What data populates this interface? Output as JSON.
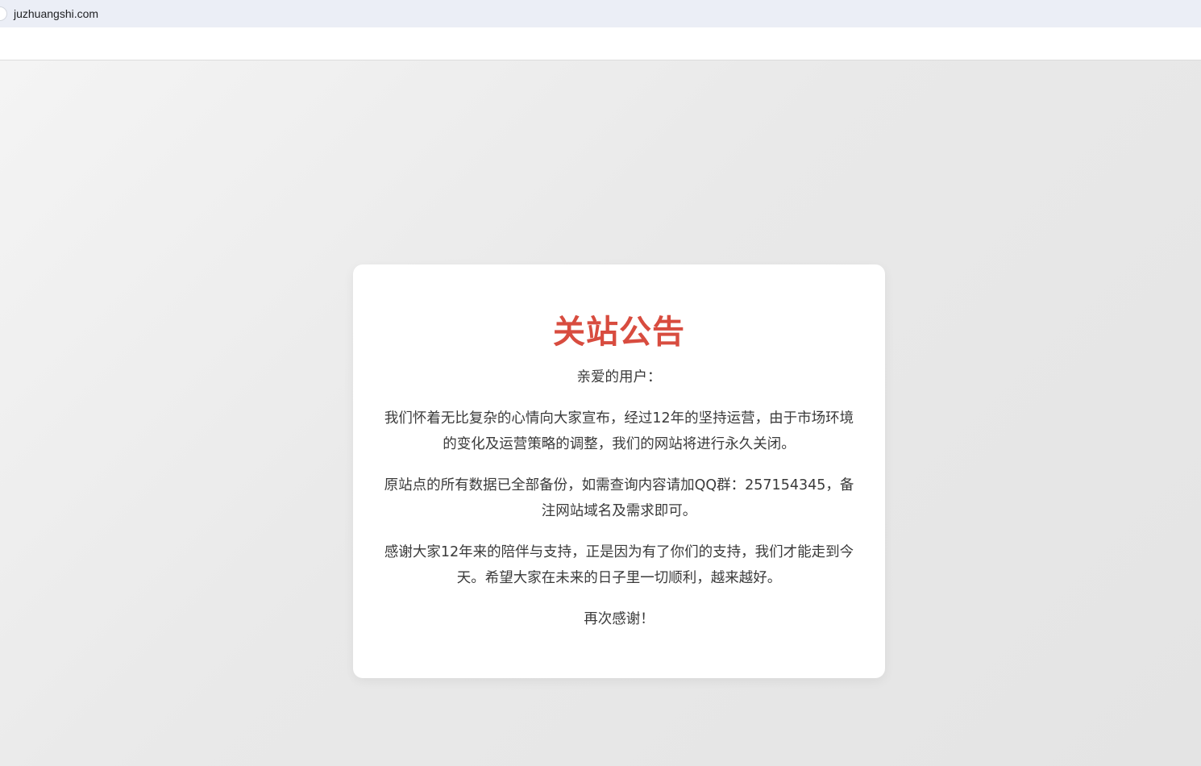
{
  "browser": {
    "url": "juzhuangshi.com"
  },
  "notice": {
    "title": "关站公告",
    "greeting": "亲爱的用户：",
    "paragraph1": "我们怀着无比复杂的心情向大家宣布，经过12年的坚持运营，由于市场环境的变化及运营策略的调整，我们的网站将进行永久关闭。",
    "paragraph2": "原站点的所有数据已全部备份，如需查询内容请加QQ群：257154345，备注网站域名及需求即可。",
    "paragraph3": "感谢大家12年来的陪伴与支持，正是因为有了你们的支持，我们才能走到今天。希望大家在未来的日子里一切顺利，越来越好。",
    "closing": "再次感谢！"
  },
  "colors": {
    "title": "#d84c3f",
    "body_text": "#3a3a3a",
    "page_background": "#e6e6e6",
    "address_bar": "#ebeef6"
  }
}
